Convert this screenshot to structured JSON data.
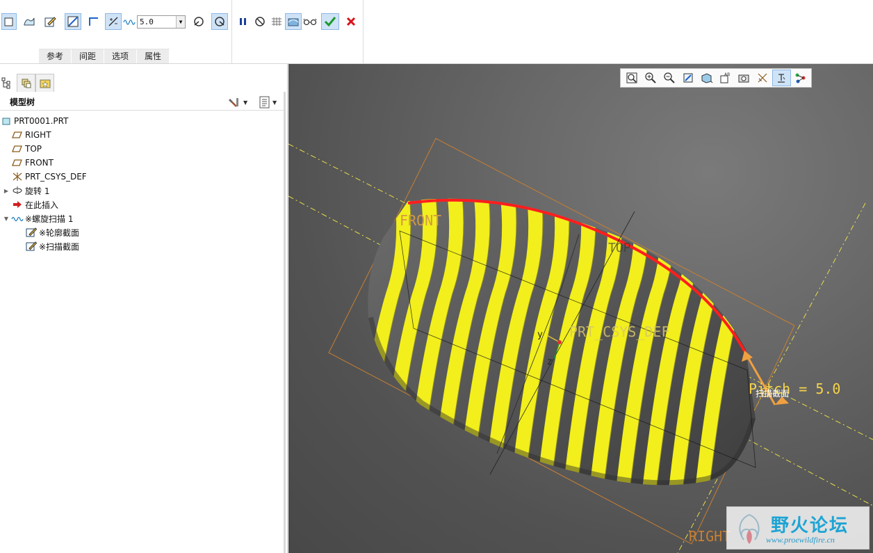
{
  "ribbon": {
    "thickness_value": "5.0",
    "tabs": [
      "参考",
      "间距",
      "选项",
      "属性"
    ]
  },
  "panel": {
    "title": "模型树",
    "tree": [
      {
        "label": "PRT0001.PRT",
        "icon": "part-icon",
        "level": 0
      },
      {
        "label": "RIGHT",
        "icon": "datum-plane-icon",
        "level": 1
      },
      {
        "label": "TOP",
        "icon": "datum-plane-icon",
        "level": 1
      },
      {
        "label": "FRONT",
        "icon": "datum-plane-icon",
        "level": 1
      },
      {
        "label": "PRT_CSYS_DEF",
        "icon": "csys-icon",
        "level": 1
      },
      {
        "label": "旋转 1",
        "icon": "revolve-icon",
        "level": 1,
        "expander": "collapsed"
      },
      {
        "label": "在此插入",
        "icon": "insert-here-icon",
        "level": 1
      },
      {
        "label": "※螺旋扫描 1",
        "icon": "helical-sweep-icon",
        "level": 1,
        "expander": "expanded"
      },
      {
        "label": "※轮廓截面",
        "icon": "sketch-icon",
        "level": 2
      },
      {
        "label": "※扫描截面",
        "icon": "sketch-icon",
        "level": 2
      }
    ]
  },
  "viewport": {
    "labels": {
      "front": "FRONT",
      "top": "TOP",
      "right": "RIGHT",
      "csys": "PRT_CSYS_DEF",
      "pitch": "Pitch = 5.0",
      "sweep_section": "扫描截面",
      "axis_y": "y",
      "axis_z": "z"
    },
    "colors": {
      "thread_yellow": "#f2ef1c",
      "sweep_red": "#ff1e1e",
      "datum_orange": "#c87f32",
      "dash_yellow": "#e8dd4a",
      "arrow": "#f0a040"
    }
  },
  "watermark": {
    "title": "野火论坛",
    "url": "www.proewildfire.cn"
  }
}
